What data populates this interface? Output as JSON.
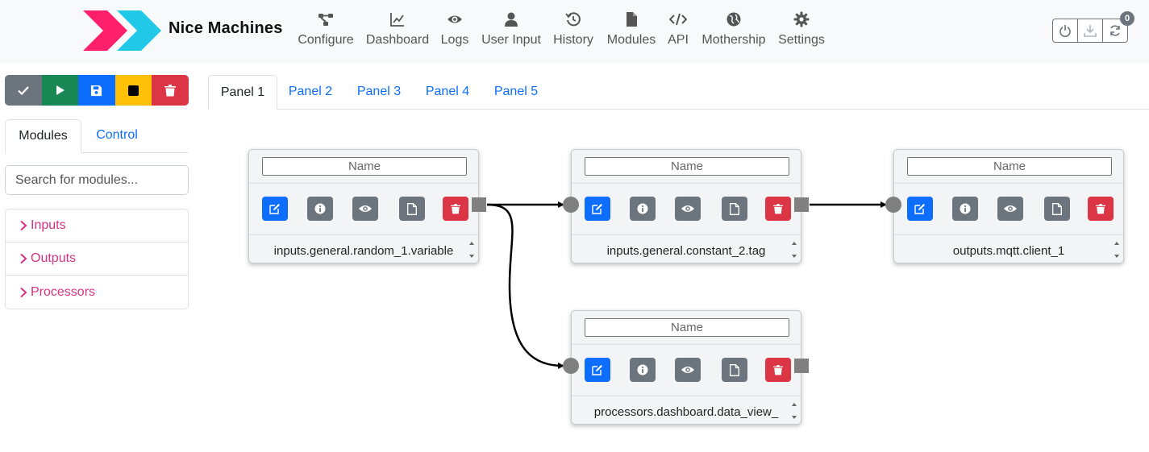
{
  "brand": {
    "name": "Nice Machines"
  },
  "nav": [
    {
      "label": "Configure",
      "icon": "diagram-icon"
    },
    {
      "label": "Dashboard",
      "icon": "chart-icon"
    },
    {
      "label": "Logs",
      "icon": "eye-icon"
    },
    {
      "label": "User Input",
      "icon": "user-icon"
    },
    {
      "label": "History",
      "icon": "history-icon"
    },
    {
      "label": "Modules",
      "icon": "file-icon"
    },
    {
      "label": "API",
      "icon": "code-icon"
    },
    {
      "label": "Mothership",
      "icon": "globe-icon"
    },
    {
      "label": "Settings",
      "icon": "gear-icon"
    }
  ],
  "header_actions": {
    "badge_count": "0",
    "icons": [
      "power-icon",
      "download-icon",
      "refresh-icon"
    ]
  },
  "toolbar": {
    "buttons": [
      {
        "icon": "check-icon",
        "color": "#6c757d"
      },
      {
        "icon": "play-icon",
        "color": "#198754"
      },
      {
        "icon": "save-icon",
        "color": "#0d6efd"
      },
      {
        "icon": "stop-icon",
        "color": "#ffc107"
      },
      {
        "icon": "trash-icon",
        "color": "#dc3545"
      }
    ]
  },
  "sidebar": {
    "tabs": [
      {
        "label": "Modules",
        "active": true
      },
      {
        "label": "Control",
        "active": false
      }
    ],
    "search_placeholder": "Search for modules...",
    "categories": [
      {
        "label": "Inputs"
      },
      {
        "label": "Outputs"
      },
      {
        "label": "Processors"
      }
    ],
    "category_color": "#d63384"
  },
  "panels": {
    "tabs": [
      {
        "label": "Panel 1"
      },
      {
        "label": "Panel 2"
      },
      {
        "label": "Panel 3"
      },
      {
        "label": "Panel 4"
      },
      {
        "label": "Panel 5"
      }
    ],
    "active": "Panel 1"
  },
  "nodes": [
    {
      "id": "random",
      "name_placeholder": "Name",
      "selected": "inputs.general.random_1.variable",
      "has_input": false,
      "has_output": true
    },
    {
      "id": "constant",
      "name_placeholder": "Name",
      "selected": "inputs.general.constant_2.tag",
      "has_input": true,
      "has_output": true
    },
    {
      "id": "mqtt",
      "name_placeholder": "Name",
      "selected": "outputs.mqtt.client_1",
      "has_input": true,
      "has_output": false
    },
    {
      "id": "dataview",
      "name_placeholder": "Name",
      "selected": "processors.dashboard.data_view_",
      "has_input": true,
      "has_output": true
    }
  ],
  "connections": [
    {
      "from": "random",
      "to": "constant"
    },
    {
      "from": "random",
      "to": "dataview"
    },
    {
      "from": "constant",
      "to": "mqtt"
    }
  ]
}
